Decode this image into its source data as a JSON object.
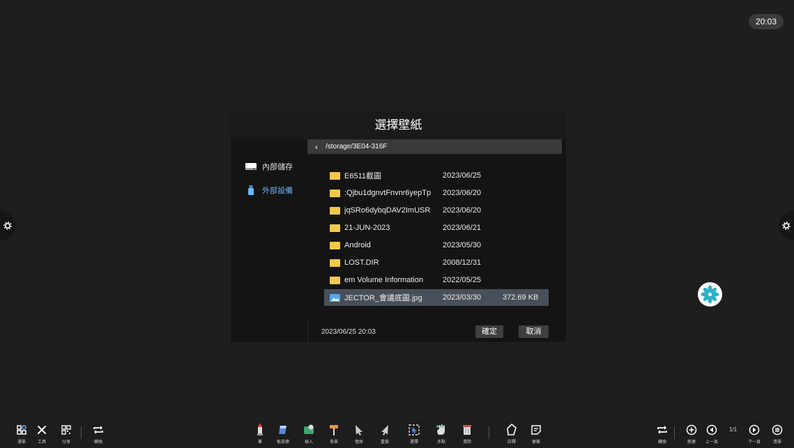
{
  "clock": "20:03",
  "dialog": {
    "title": "選擇壁紙",
    "storage": [
      {
        "label": "內部儲存",
        "icon": "drive-icon",
        "active": false
      },
      {
        "label": "外部設備",
        "icon": "usb-icon",
        "active": true
      }
    ],
    "path": "/storage/3E04-316F",
    "files": [
      {
        "name": "E6511截圖",
        "date": "2023/06/25",
        "size": "",
        "type": "folder"
      },
      {
        "name": ":Qjbu1dgnvtFnvnr6yepTp",
        "date": "2023/06/20",
        "size": "",
        "type": "folder"
      },
      {
        "name": "jqSRo6dybqDAV2ImUSR",
        "date": "2023/06/20",
        "size": "",
        "type": "folder"
      },
      {
        "name": "21-JUN-2023",
        "date": "2023/06/21",
        "size": "",
        "type": "folder"
      },
      {
        "name": "Android",
        "date": "2023/05/30",
        "size": "",
        "type": "folder"
      },
      {
        "name": "LOST.DIR",
        "date": "2008/12/31",
        "size": "",
        "type": "folder"
      },
      {
        "name": "em Volume Information",
        "date": "2022/05/25",
        "size": "",
        "type": "folder"
      },
      {
        "name": "JECTOR_會議底圖.jpg",
        "date": "2023/03/30",
        "size": "372.69 KB",
        "type": "image"
      }
    ],
    "footer_date": "2023/06/25 20:03",
    "ok_label": "確定",
    "cancel_label": "取消"
  },
  "toolbar": {
    "left": [
      {
        "label": "選單",
        "icon": "apps-icon"
      },
      {
        "label": "工具",
        "icon": "tools-icon"
      },
      {
        "label": "分享",
        "icon": "qr-icon"
      },
      {
        "label": "轉換",
        "icon": "switch-icon"
      }
    ],
    "center": [
      {
        "label": "筆",
        "icon": "pen-icon"
      },
      {
        "label": "板皮擦",
        "icon": "eraser-icon"
      },
      {
        "label": "插入",
        "icon": "insert-icon"
      },
      {
        "label": "背景",
        "icon": "background-icon"
      },
      {
        "label": "復原",
        "icon": "undo-icon"
      },
      {
        "label": "重做",
        "icon": "redo-icon"
      },
      {
        "label": "選擇",
        "icon": "select-icon"
      },
      {
        "label": "多點",
        "icon": "multitouch-icon"
      },
      {
        "label": "清除",
        "icon": "clear-icon"
      },
      {
        "label": "註釋",
        "icon": "annotate-icon"
      },
      {
        "label": "便簽",
        "icon": "note-icon"
      }
    ],
    "right": [
      {
        "label": "轉換",
        "icon": "switch-icon"
      },
      {
        "label": "新建",
        "icon": "add-icon"
      },
      {
        "label": "上一頁",
        "icon": "prev-icon"
      },
      {
        "label": "下一頁",
        "icon": "next-icon"
      },
      {
        "label": "清單",
        "icon": "list-icon"
      }
    ],
    "page_indicator": "1/1"
  }
}
